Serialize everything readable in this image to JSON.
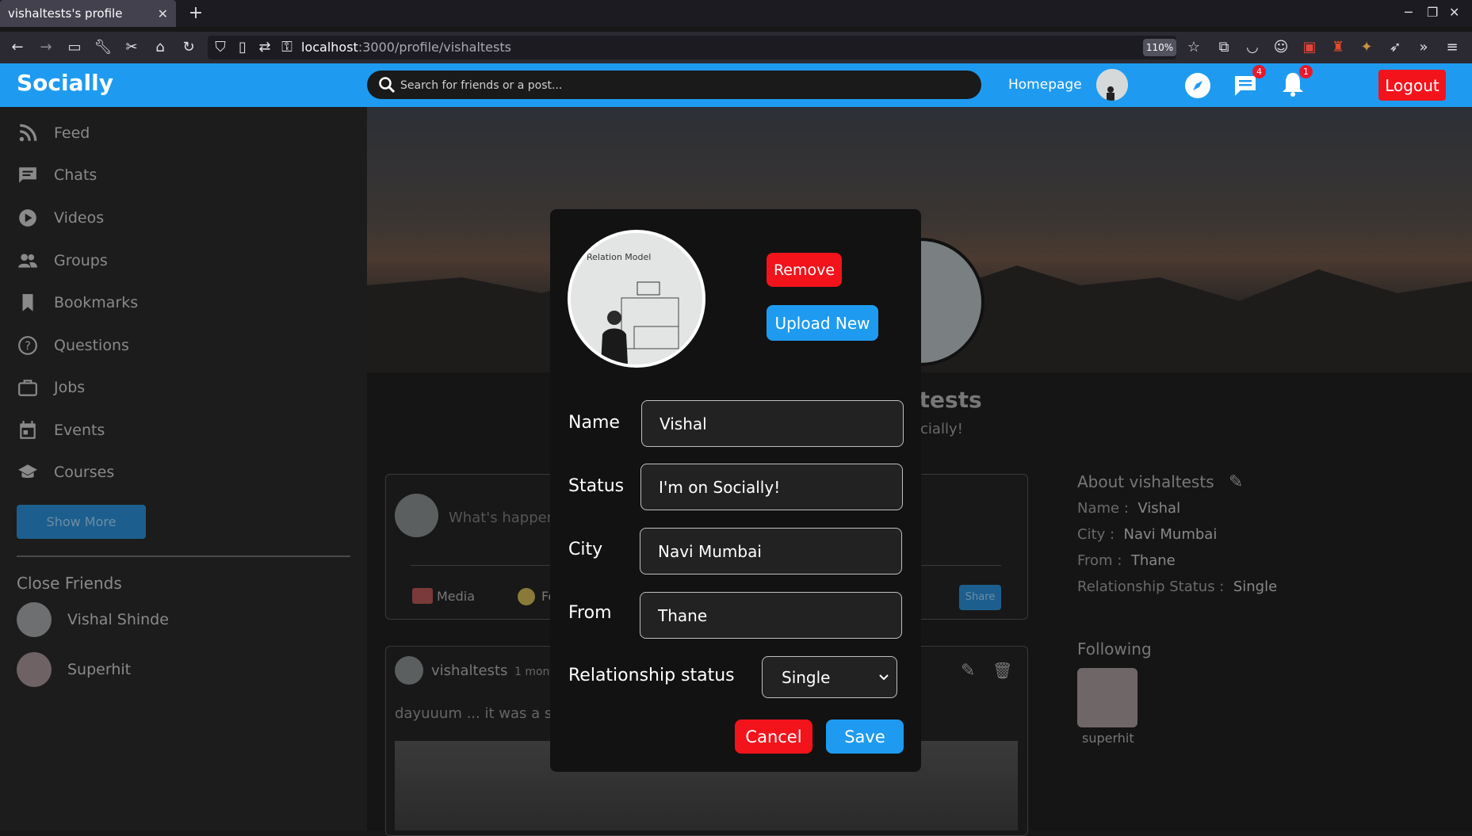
{
  "browser": {
    "tab_title": "vishaltests's profile",
    "url_host": "localhost",
    "url_path": ":3000/profile/vishaltests",
    "zoom": "110%"
  },
  "header": {
    "logo": "Socially",
    "search_placeholder": "Search for friends or a post...",
    "homepage_label": "Homepage",
    "chat_badge": "4",
    "notification_badge": "1",
    "logout_label": "Logout",
    "accent_color": "#1e9bf0"
  },
  "sidebar": {
    "items": [
      {
        "label": "Feed",
        "icon": "rss-icon"
      },
      {
        "label": "Chats",
        "icon": "chat-icon"
      },
      {
        "label": "Videos",
        "icon": "play-circle-icon"
      },
      {
        "label": "Groups",
        "icon": "group-icon"
      },
      {
        "label": "Bookmarks",
        "icon": "bookmark-icon"
      },
      {
        "label": "Questions",
        "icon": "help-circle-icon"
      },
      {
        "label": "Jobs",
        "icon": "briefcase-icon"
      },
      {
        "label": "Events",
        "icon": "calendar-icon"
      },
      {
        "label": "Courses",
        "icon": "school-icon"
      }
    ],
    "show_more_label": "Show More",
    "close_friends_title": "Close Friends",
    "friends": [
      "Vishal Shinde",
      "Superhit"
    ]
  },
  "profile": {
    "name_partial": "ltests",
    "status_partial": "ocially!",
    "compose_placeholder": "What's happen",
    "media_label": "Media",
    "feeling_partial": "Fe",
    "share_label": "Share",
    "post_author": "vishaltests",
    "post_time": "1 mont",
    "post_text": "dayuuum ... it was a su"
  },
  "about": {
    "title": "About vishaltests",
    "rows": [
      {
        "key": "Name :",
        "value": "Vishal"
      },
      {
        "key": "City :",
        "value": "Navi Mumbai"
      },
      {
        "key": "From :",
        "value": "Thane"
      },
      {
        "key": "Relationship Status :",
        "value": "Single"
      }
    ],
    "following_title": "Following",
    "following_name": "superhit"
  },
  "modal": {
    "avatar_caption": "Relation Model",
    "remove_label": "Remove",
    "upload_label": "Upload New",
    "fields": {
      "name_label": "Name",
      "name_value": "Vishal",
      "status_label": "Status",
      "status_value": "I'm on Socially!",
      "city_label": "City",
      "city_value": "Navi Mumbai",
      "from_label": "From",
      "from_value": "Thane",
      "relationship_label": "Relationship status",
      "relationship_value": "Single"
    },
    "cancel_label": "Cancel",
    "save_label": "Save"
  }
}
